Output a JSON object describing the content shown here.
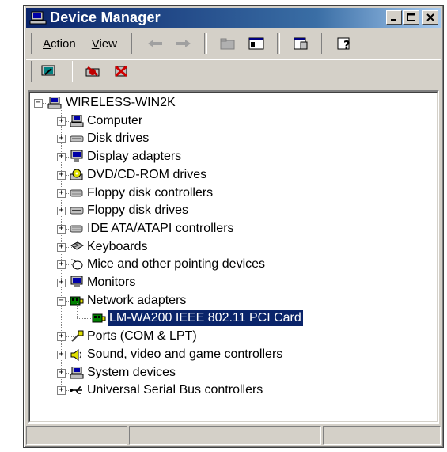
{
  "window": {
    "title": "Device Manager"
  },
  "menu": {
    "action": {
      "accel": "A",
      "rest": "ction"
    },
    "view": {
      "accel": "V",
      "rest": "iew"
    }
  },
  "tree": {
    "root": "WIRELESS-WIN2K",
    "items": [
      {
        "label": "Computer",
        "icon": "computer-icon"
      },
      {
        "label": "Disk drives",
        "icon": "disk-drive-icon"
      },
      {
        "label": "Display adapters",
        "icon": "display-adapter-icon"
      },
      {
        "label": "DVD/CD-ROM drives",
        "icon": "cdrom-icon"
      },
      {
        "label": "Floppy disk controllers",
        "icon": "floppy-controller-icon"
      },
      {
        "label": "Floppy disk drives",
        "icon": "floppy-drive-icon"
      },
      {
        "label": "IDE ATA/ATAPI controllers",
        "icon": "ide-controller-icon"
      },
      {
        "label": "Keyboards",
        "icon": "keyboard-icon"
      },
      {
        "label": "Mice and other pointing devices",
        "icon": "mouse-icon"
      },
      {
        "label": "Monitors",
        "icon": "monitor-icon"
      },
      {
        "label": "Network adapters",
        "icon": "network-adapter-icon",
        "expanded": true
      },
      {
        "label": "LM-WA200 IEEE 802.11 PCI Card",
        "icon": "network-card-icon",
        "child": true,
        "selected": true
      },
      {
        "label": "Ports (COM & LPT)",
        "icon": "port-icon"
      },
      {
        "label": "Sound, video and game controllers",
        "icon": "speaker-icon"
      },
      {
        "label": "System devices",
        "icon": "system-device-icon"
      },
      {
        "label": "Universal Serial Bus controllers",
        "icon": "usb-icon"
      }
    ]
  },
  "colors": {
    "selection": "#0a246a",
    "face": "#d4d0c8",
    "title_start": "#0a246a",
    "title_end": "#a6caf0"
  }
}
